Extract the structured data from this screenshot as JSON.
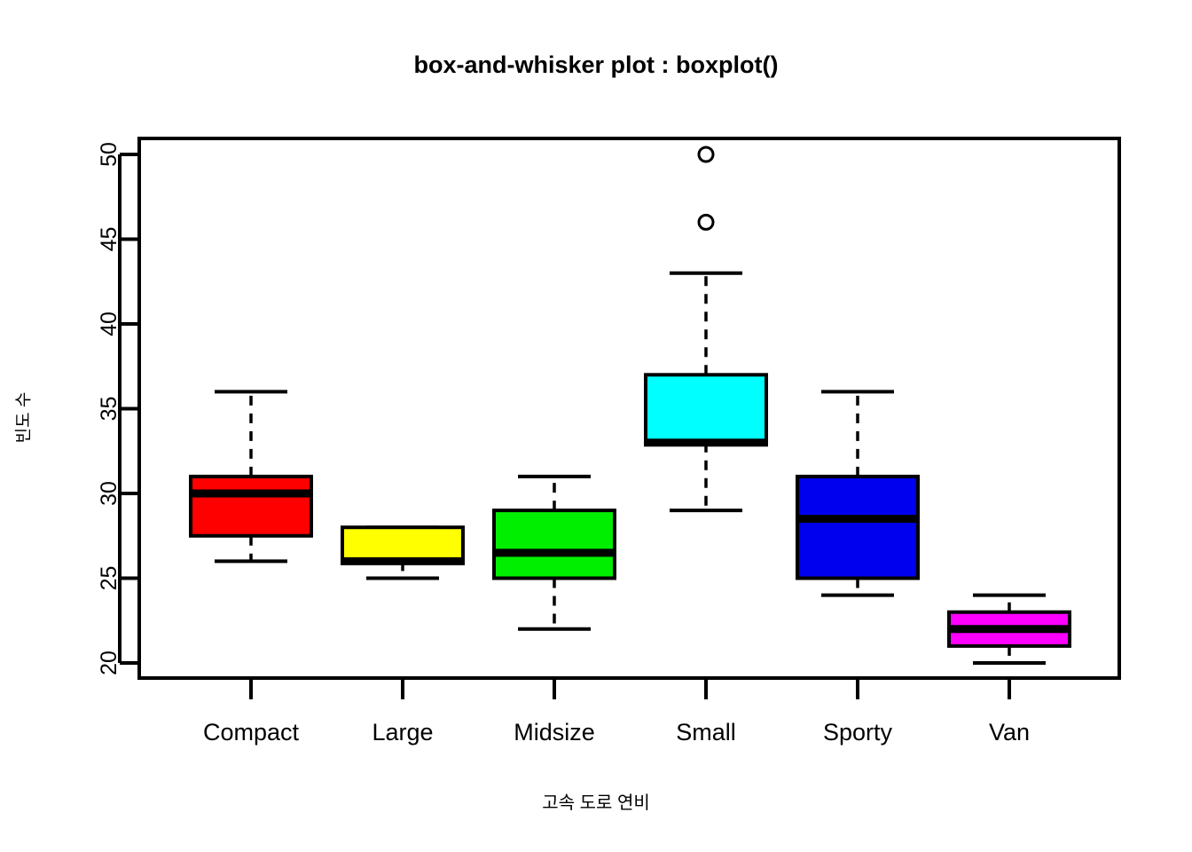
{
  "chart_data": {
    "type": "boxplot",
    "title": "box-and-whisker plot : boxplot()",
    "xlabel": "고속 도로 연비",
    "ylabel": "빈도 수",
    "categories": [
      "Compact",
      "Large",
      "Midsize",
      "Small",
      "Sporty",
      "Van"
    ],
    "ylim": [
      18.8,
      51.0
    ],
    "yticks": [
      20,
      25,
      30,
      35,
      40,
      45,
      50
    ],
    "grid": false,
    "legend": "none",
    "box_colors": [
      "#ff0000",
      "#ffff00",
      "#00ee00",
      "#00ffff",
      "#0000ee",
      "#ff00ff"
    ],
    "boxes": [
      {
        "name": "Compact",
        "color": "#ff0000",
        "whisker_low": 26,
        "q1": 27.5,
        "median": 30,
        "q3": 31,
        "whisker_high": 36,
        "outliers": []
      },
      {
        "name": "Large",
        "color": "#ffff00",
        "whisker_low": 25,
        "q1": 26,
        "median": 26,
        "q3": 28,
        "whisker_high": 28,
        "outliers": []
      },
      {
        "name": "Midsize",
        "color": "#00ee00",
        "whisker_low": 22,
        "q1": 25,
        "median": 26.5,
        "q3": 29,
        "whisker_high": 31,
        "outliers": []
      },
      {
        "name": "Small",
        "color": "#00ffff",
        "whisker_low": 29,
        "q1": 33,
        "median": 33,
        "q3": 37,
        "whisker_high": 43,
        "outliers": [
          46,
          50
        ]
      },
      {
        "name": "Sporty",
        "color": "#0000ee",
        "whisker_low": 24,
        "q1": 25,
        "median": 28.5,
        "q3": 31,
        "whisker_high": 36,
        "outliers": []
      },
      {
        "name": "Van",
        "color": "#ff00ff",
        "whisker_low": 20,
        "q1": 21,
        "median": 22,
        "q3": 23,
        "whisker_high": 24,
        "outliers": []
      }
    ]
  },
  "axis": {
    "y_tick_labels": [
      "20",
      "25",
      "30",
      "35",
      "40",
      "45",
      "50"
    ],
    "x_tick_labels": [
      "Compact",
      "Large",
      "Midsize",
      "Small",
      "Sporty",
      "Van"
    ]
  },
  "title": "box-and-whisker plot : boxplot()",
  "x_title": "고속 도로 연비",
  "y_title": "빈도 수"
}
